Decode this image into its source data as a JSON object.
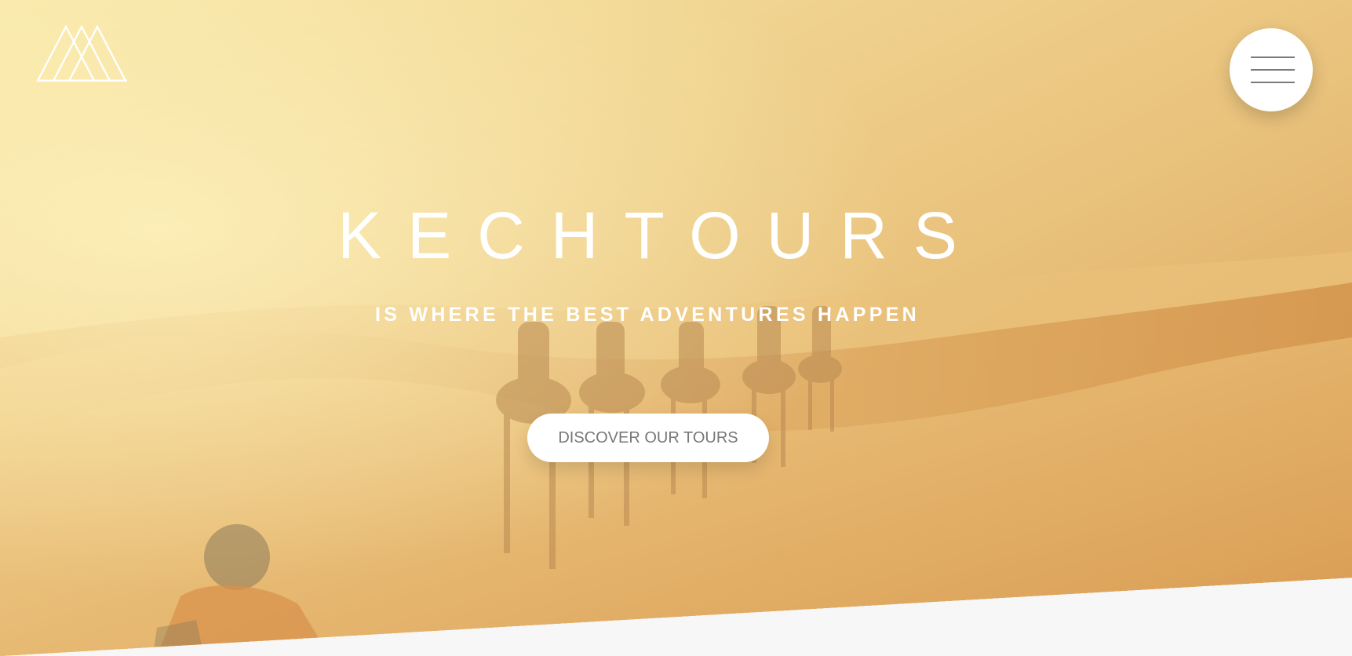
{
  "header": {
    "logo_icon": "mountain-logo-icon",
    "menu_icon": "hamburger-menu-icon"
  },
  "hero": {
    "title": "KECHTOURS",
    "tagline": "IS WHERE THE BEST ADVENTURES HAPPEN",
    "cta_label": "DISCOVER OUR TOURS"
  },
  "colors": {
    "overlay_light": "#f6df98",
    "overlay_dark": "#cf8e45",
    "text": "#ffffff",
    "button_bg": "#ffffff",
    "button_text": "#777777",
    "page_bg": "#f7f7f7"
  }
}
